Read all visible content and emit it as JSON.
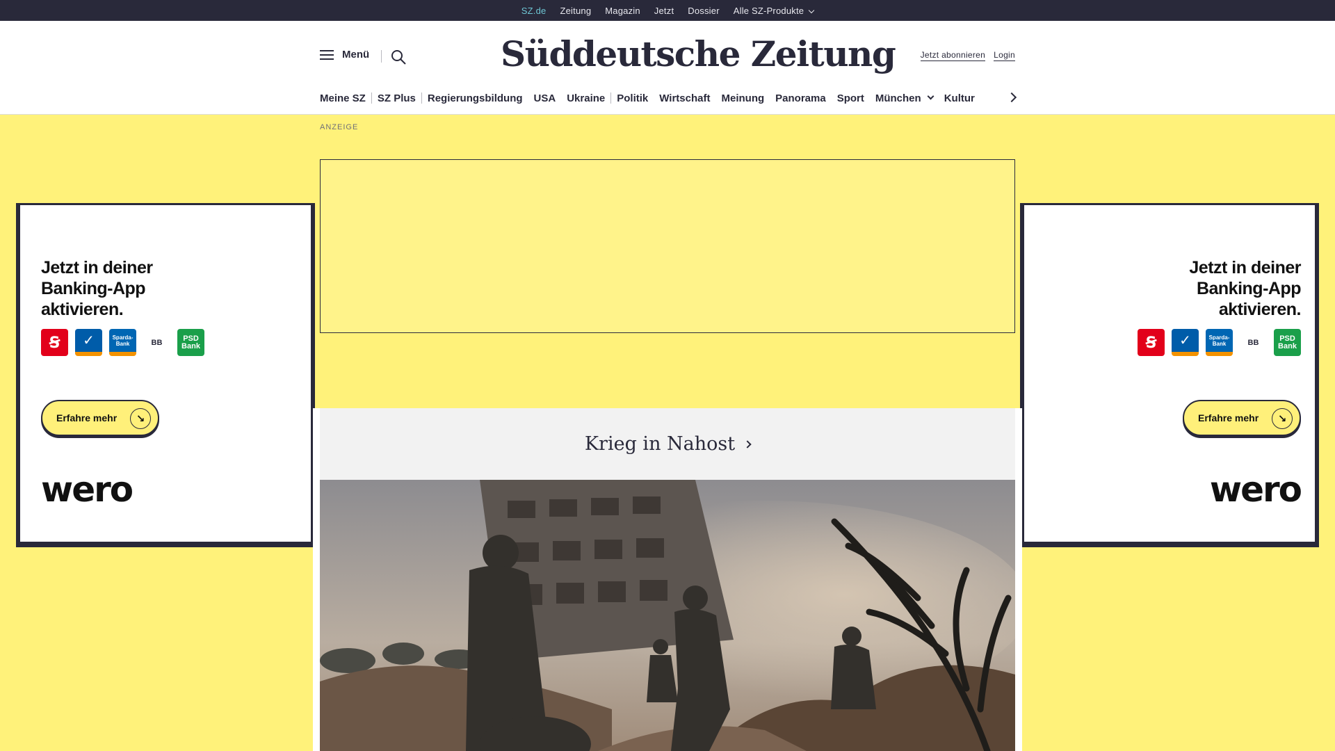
{
  "topbar": {
    "items": [
      {
        "label": "SZ.de",
        "active": true
      },
      {
        "label": "Zeitung"
      },
      {
        "label": "Magazin"
      },
      {
        "label": "Jetzt"
      },
      {
        "label": "Dossier"
      },
      {
        "label": "Alle SZ-Produkte",
        "has_dropdown": true
      }
    ]
  },
  "header": {
    "menu_label": "Menü",
    "logo_text": "Süddeutsche Zeitung",
    "subscribe_label": "Jetzt abonnieren",
    "login_label": "Login"
  },
  "nav": {
    "items": [
      "Meine SZ",
      "SZ Plus",
      "Regierungsbildung",
      "USA",
      "Ukraine",
      "Politik",
      "Wirtschaft",
      "Meinung",
      "Panorama",
      "Sport",
      "München",
      "Kultur"
    ]
  },
  "ad": {
    "label": "ANZEIGE",
    "side_copy": "Jetzt in deiner Banking-App aktivieren.",
    "banks": [
      "Sparkasse",
      "Volksbank",
      "Sparda-Bank",
      "BBBank",
      "PSD Bank"
    ],
    "sparda_label": "Sparda-Bank",
    "bb_label": "BB",
    "psd_label": "PSD Bank",
    "cta_label": "Erfahre mehr",
    "brand": "wero"
  },
  "colors": {
    "background": "#fff27a",
    "dark": "#29293a",
    "accent_link": "#6ec6d4"
  },
  "content": {
    "dossier_title": "Krieg in Nahost"
  }
}
